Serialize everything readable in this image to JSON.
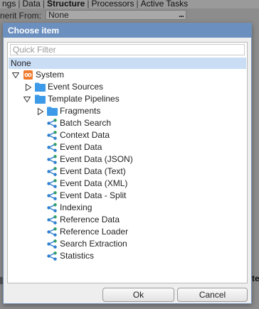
{
  "background": {
    "tabs": [
      "ngs",
      "Data",
      "Structure",
      "Processors",
      "Active Tasks"
    ],
    "active_tab": "Structure",
    "inherit_label": "nerit From:",
    "inherit_value": "None",
    "inherit_button": "...",
    "right_fragment": "te"
  },
  "dialog": {
    "title": "Choose item",
    "filter_placeholder": "Quick Filter",
    "none_label": "None",
    "tree": {
      "system": "System",
      "event_sources": "Event Sources",
      "template_pipelines": "Template Pipelines",
      "fragments": "Fragments",
      "pipelines": [
        "Batch Search",
        "Context Data",
        "Event Data",
        "Event Data (JSON)",
        "Event Data (Text)",
        "Event Data (XML)",
        "Event Data - Split",
        "Indexing",
        "Reference Data",
        "Reference Loader",
        "Search Extraction",
        "Statistics"
      ]
    },
    "ok_label": "Ok",
    "cancel_label": "Cancel"
  },
  "colors": {
    "title_bar": "#6b8fbf",
    "selection": "#c9def5",
    "folder": "#3d9ae8",
    "system_icon": "#f07a2b",
    "pipeline_icon": "#2e7fcf",
    "pipeline_green": "#2ea44f"
  }
}
